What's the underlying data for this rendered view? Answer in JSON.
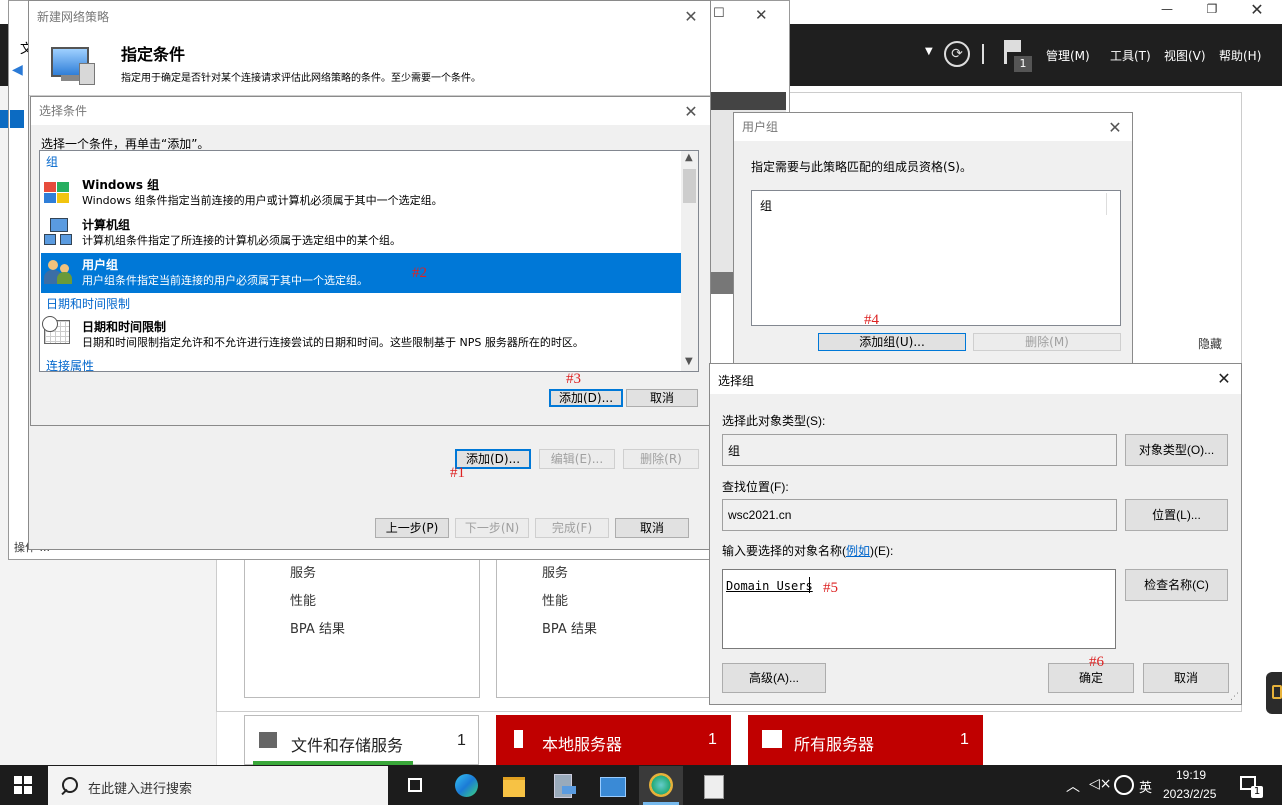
{
  "server_manager": {
    "menu": [
      "管理(M)",
      "工具(T)",
      "视图(V)",
      "帮助(H)"
    ],
    "flag_count": "1",
    "hide_label": "隐藏",
    "left_partial": [
      "文",
      "操"
    ],
    "left_status": "操作 ..."
  },
  "role_boxes": {
    "left": [
      "服务",
      "性能",
      "BPA 结果"
    ],
    "right": [
      "服务",
      "性能",
      "BPA 结果"
    ]
  },
  "tiles": [
    {
      "label": "文件和存储服务",
      "count": "1"
    },
    {
      "label": "本地服务器",
      "count": "1"
    },
    {
      "label": "所有服务器",
      "count": "1"
    }
  ],
  "wizard": {
    "title": "新建网络策略",
    "heading": "指定条件",
    "subtitle": "指定用于确定是否针对某个连接请求评估此网络策略的条件。至少需要一个条件。",
    "add": "添加(D)...",
    "edit": "编辑(E)...",
    "remove": "删除(R)",
    "back": "上一步(P)",
    "next": "下一步(N)",
    "finish": "完成(F)",
    "cancel": "取消"
  },
  "select_condition": {
    "title": "选择条件",
    "instruction": "选择一个条件，再单击“添加”。",
    "categories": [
      "组",
      "日期和时间限制",
      "连接属性"
    ],
    "items": [
      {
        "title": "Windows 组",
        "desc": "Windows 组条件指定当前连接的用户或计算机必须属于其中一个选定组。"
      },
      {
        "title": "计算机组",
        "desc": "计算机组条件指定了所连接的计算机必须属于选定组中的某个组。"
      },
      {
        "title": "用户组",
        "desc": "用户组条件指定当前连接的用户必须属于其中一个选定组。"
      },
      {
        "title": "日期和时间限制",
        "desc": "日期和时间限制指定允许和不允许进行连接尝试的日期和时间。这些限制基于 NPS 服务器所在的时区。"
      }
    ],
    "add": "添加(D)...",
    "cancel": "取消"
  },
  "user_group": {
    "title": "用户组",
    "desc": "指定需要与此策略匹配的组成员资格(S)。",
    "column": "组",
    "add": "添加组(U)...",
    "remove": "删除(M)"
  },
  "select_group": {
    "title": "选择组",
    "type_label": "选择此对象类型(S):",
    "type_value": "组",
    "type_btn": "对象类型(O)...",
    "loc_label": "查找位置(F):",
    "loc_value": "wsc2021.cn",
    "loc_btn": "位置(L)...",
    "name_label_pre": "输入要选择的对象名称(",
    "name_label_link": "例如",
    "name_label_post": ")(E):",
    "name_value": "Domain Users",
    "check_btn": "检查名称(C)",
    "advanced": "高级(A)...",
    "ok": "确定",
    "cancel": "取消"
  },
  "annotations": [
    "#1",
    "#2",
    "#3",
    "#4",
    "#5",
    "#6"
  ],
  "taskbar": {
    "search_placeholder": "在此键入进行搜索",
    "ime": "英",
    "time": "19:19",
    "date": "2023/2/25",
    "notification_count": "1"
  }
}
